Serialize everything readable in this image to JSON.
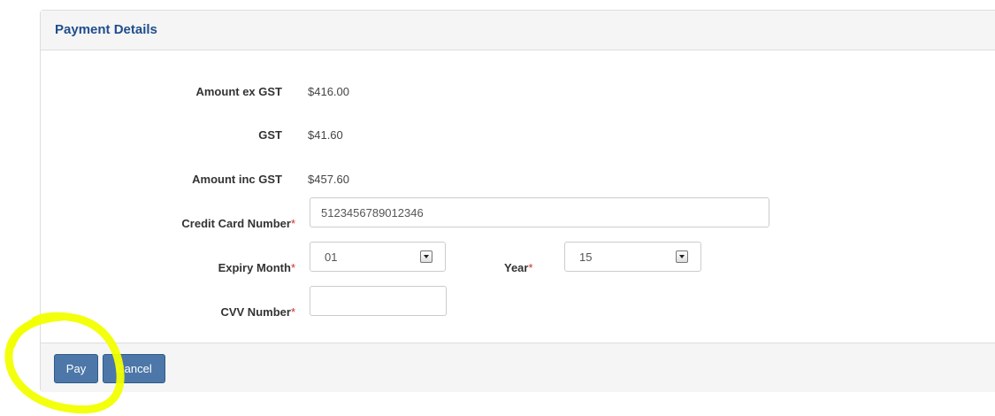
{
  "panel": {
    "title": "Payment Details"
  },
  "summary": {
    "amount_ex_gst_label": "Amount ex GST",
    "amount_ex_gst_value": "$416.00",
    "gst_label": "GST",
    "gst_value": "$41.60",
    "amount_inc_gst_label": "Amount inc GST",
    "amount_inc_gst_value": "$457.60"
  },
  "form": {
    "required_marker": "*",
    "credit_card_label": "Credit Card Number",
    "credit_card_value": "5123456789012346",
    "expiry_month_label": "Expiry Month",
    "expiry_month_value": "01",
    "year_label": "Year",
    "year_value": "15",
    "cvv_label": "CVV Number",
    "cvv_value": ""
  },
  "footer": {
    "pay_label": "Pay",
    "cancel_label": "Cancel"
  },
  "colors": {
    "title": "#1f4e8c",
    "button": "#4c77a8",
    "required": "#c9302c",
    "highlight": "#f2ff00"
  }
}
